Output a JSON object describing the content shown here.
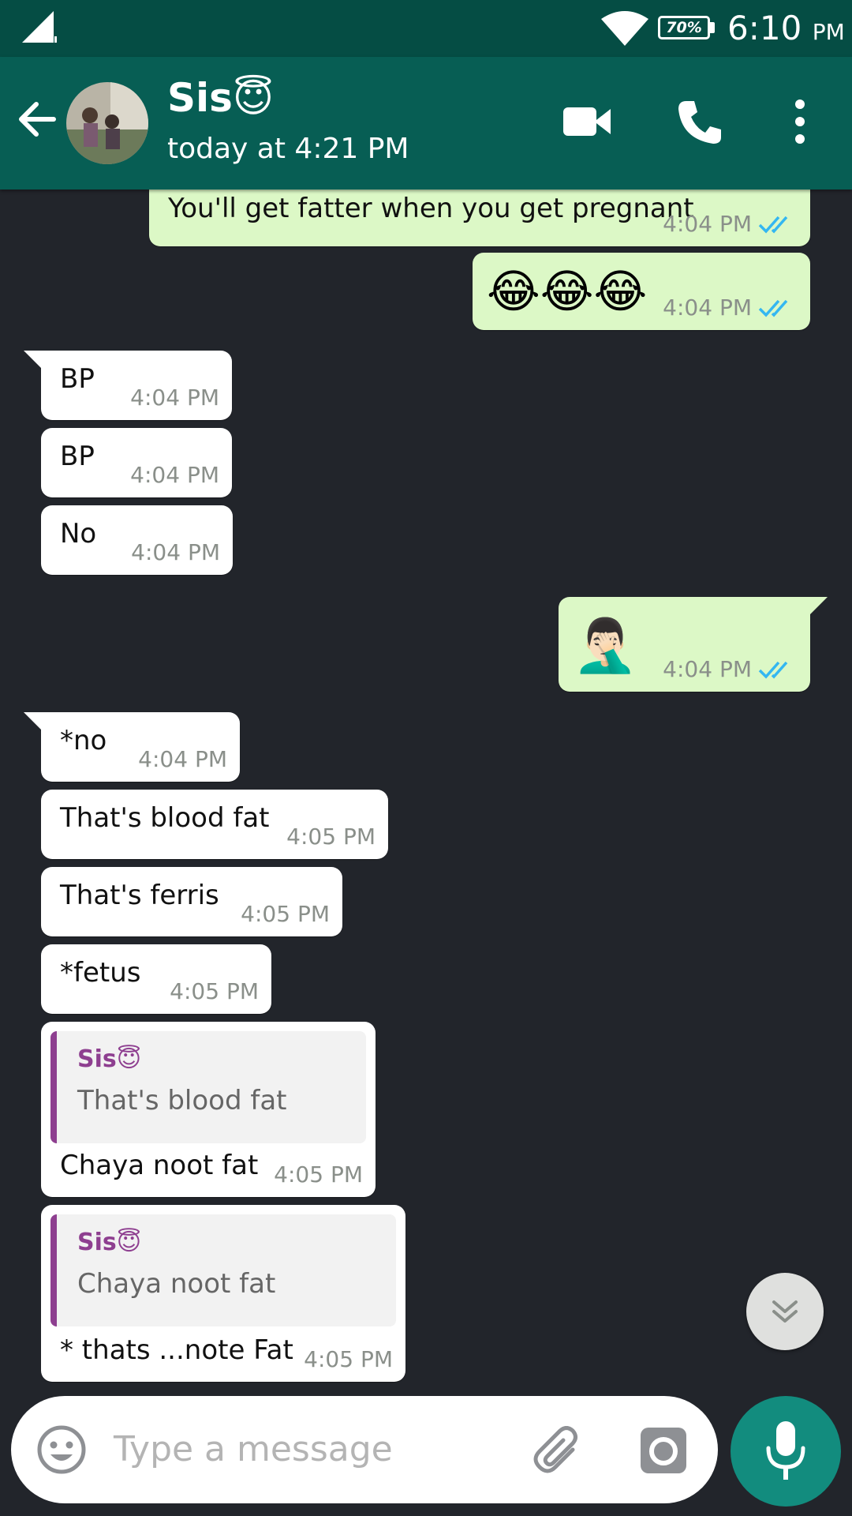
{
  "status_bar": {
    "battery": "70%",
    "time": "6:10",
    "ampm": "PM"
  },
  "header": {
    "contact_name": "Sis😇",
    "last_seen": "today at 4:21 PM"
  },
  "messages": [
    {
      "direction": "out",
      "text": "You'll get fatter when you get pregnant",
      "time": "4:04 PM",
      "status": "read"
    },
    {
      "direction": "out",
      "text": "😂😂😂",
      "time": "4:04 PM",
      "status": "read"
    },
    {
      "direction": "in",
      "text": "BP",
      "time": "4:04 PM"
    },
    {
      "direction": "in",
      "text": "BP",
      "time": "4:04 PM"
    },
    {
      "direction": "in",
      "text": "No",
      "time": "4:04 PM"
    },
    {
      "direction": "out",
      "text": "🤦🏻‍♂️",
      "time": "4:04 PM",
      "status": "read"
    },
    {
      "direction": "in",
      "text": "*no",
      "time": "4:04 PM"
    },
    {
      "direction": "in",
      "text": "That's blood fat",
      "time": "4:05 PM"
    },
    {
      "direction": "in",
      "text": "That's ferris",
      "time": "4:05 PM"
    },
    {
      "direction": "in",
      "text": "*fetus",
      "time": "4:05 PM"
    },
    {
      "direction": "in",
      "quote_author": "Sis😇",
      "quote_text": "That's blood fat",
      "text": "Chaya noot fat",
      "time": "4:05 PM"
    },
    {
      "direction": "in",
      "quote_author": "Sis😇",
      "quote_text": "Chaya noot fat",
      "text": "* thats ...note Fat",
      "time": "4:05 PM"
    }
  ],
  "composer": {
    "placeholder": "Type a message"
  },
  "colors": {
    "header": "#075e54",
    "status_bar": "#054d44",
    "outgoing_bubble": "#dcf8c6",
    "incoming_bubble": "#ffffff",
    "read_ticks": "#34b7f1",
    "quote_accent": "#8e3f90",
    "mic_button": "#128c7e",
    "chat_background": "#22252b"
  },
  "icons": [
    "signal-icon",
    "wifi-icon",
    "battery-icon",
    "back-arrow-icon",
    "video-call-icon",
    "phone-call-icon",
    "more-options-icon",
    "double-check-icon",
    "scroll-down-icon",
    "emoji-icon",
    "attach-icon",
    "camera-icon",
    "mic-icon"
  ]
}
